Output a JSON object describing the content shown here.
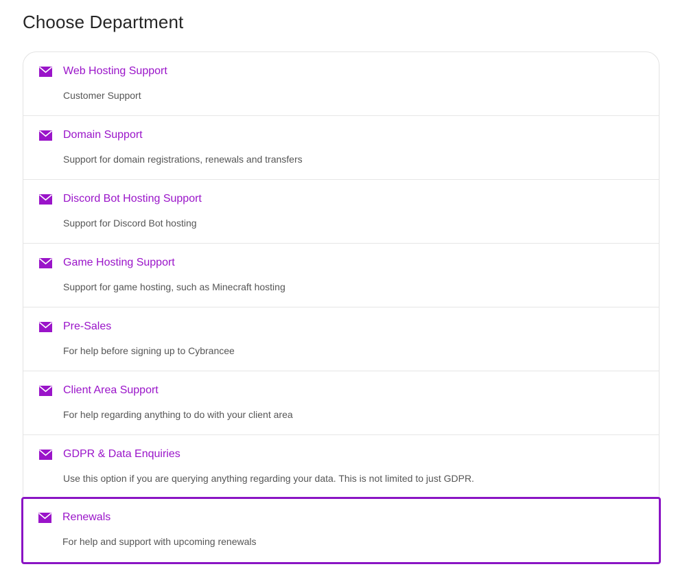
{
  "page": {
    "title": "Choose Department"
  },
  "colors": {
    "accent": "#9a14c9",
    "selected_border": "#8a14c4",
    "description_text": "#555555",
    "divider": "#e6e6e6"
  },
  "icons": {
    "department": "mail-icon"
  },
  "departments": [
    {
      "name": "Web Hosting Support",
      "description": "Customer Support",
      "selected": false
    },
    {
      "name": "Domain Support",
      "description": "Support for domain registrations, renewals and transfers",
      "selected": false
    },
    {
      "name": "Discord Bot Hosting Support",
      "description": "Support for Discord Bot hosting",
      "selected": false
    },
    {
      "name": "Game Hosting Support",
      "description": "Support for game hosting, such as Minecraft hosting",
      "selected": false
    },
    {
      "name": "Pre-Sales",
      "description": "For help before signing up to Cybrancee",
      "selected": false
    },
    {
      "name": "Client Area Support",
      "description": "For help regarding anything to do with your client area",
      "selected": false
    },
    {
      "name": "GDPR & Data Enquiries",
      "description": "Use this option if you are querying anything regarding your data. This is not limited to just GDPR.",
      "selected": false
    },
    {
      "name": "Renewals",
      "description": "For help and support with upcoming renewals",
      "selected": true
    }
  ]
}
